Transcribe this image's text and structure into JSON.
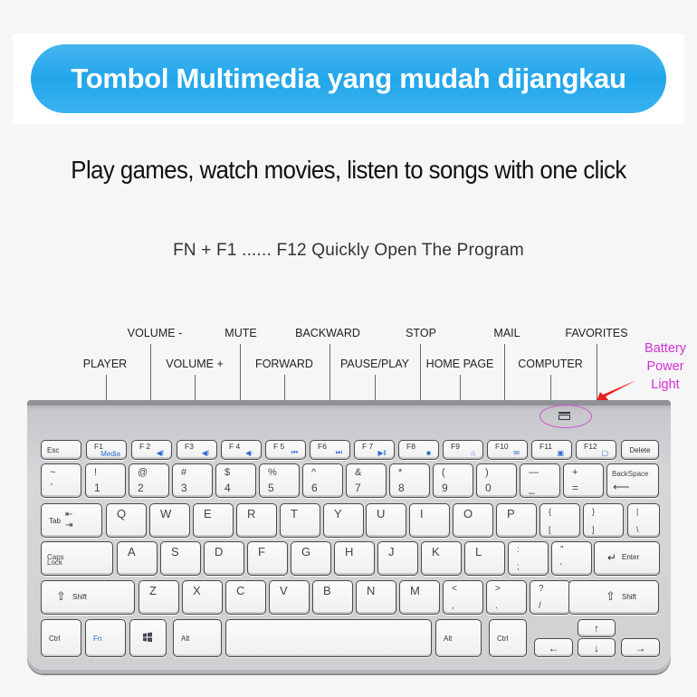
{
  "banner": {
    "title": "Tombol Multimedia yang mudah dijangkau",
    "color": "#22a6ec"
  },
  "subtitle": "Play games, watch movies, listen to songs with one click",
  "caption": "FN + F1 ...... F12 Quickly Open The Program",
  "function_labels": [
    {
      "key": "F1",
      "label": "PLAYER",
      "row": "lower"
    },
    {
      "key": "F2",
      "label": "VOLUME -",
      "row": "upper"
    },
    {
      "key": "F3",
      "label": "VOLUME +",
      "row": "lower"
    },
    {
      "key": "F4",
      "label": "MUTE",
      "row": "upper"
    },
    {
      "key": "F5",
      "label": "FORWARD",
      "row": "lower"
    },
    {
      "key": "F6",
      "label": "BACKWARD",
      "row": "upper"
    },
    {
      "key": "F7",
      "label": "PAUSE/PLAY",
      "row": "lower"
    },
    {
      "key": "F8",
      "label": "STOP",
      "row": "upper"
    },
    {
      "key": "F9",
      "label": "HOME PAGE",
      "row": "lower"
    },
    {
      "key": "F10",
      "label": "MAIL",
      "row": "upper"
    },
    {
      "key": "F11",
      "label": "COMPUTER",
      "row": "lower"
    },
    {
      "key": "F12",
      "label": "FAVORITES",
      "row": "upper"
    }
  ],
  "battery": {
    "label_lines": [
      "Battery",
      "Power",
      "Light"
    ],
    "color": "#d231d6",
    "icon": "battery-icon"
  },
  "keyboard": {
    "fn_row": [
      {
        "name": "Esc"
      },
      {
        "name": "F1",
        "sub": "Media"
      },
      {
        "name": "F 2",
        "icon": "◀ǀ"
      },
      {
        "name": "F3",
        "icon": "◀ǀ"
      },
      {
        "name": "F 4",
        "icon": "◀·"
      },
      {
        "name": "F 5",
        "icon": "⏮"
      },
      {
        "name": "F6",
        "icon": "⏭"
      },
      {
        "name": "F 7",
        "icon": "▶ǁ"
      },
      {
        "name": "F8",
        "icon": "■"
      },
      {
        "name": "F9",
        "icon": "⌂"
      },
      {
        "name": "F10",
        "icon": "✉"
      },
      {
        "name": "F11",
        "icon": "▣"
      },
      {
        "name": "F12",
        "icon": "▢"
      },
      {
        "name": "Delete"
      }
    ],
    "number_row": [
      {
        "top": "~",
        "bottom": "`"
      },
      {
        "top": "!",
        "bottom": "1"
      },
      {
        "top": "@",
        "bottom": "2"
      },
      {
        "top": "#",
        "bottom": "3"
      },
      {
        "top": "$",
        "bottom": "4"
      },
      {
        "top": "%",
        "bottom": "5"
      },
      {
        "top": "^",
        "bottom": "6"
      },
      {
        "top": "&",
        "bottom": "7"
      },
      {
        "top": "*",
        "bottom": "8"
      },
      {
        "top": "(",
        "bottom": "9"
      },
      {
        "top": ")",
        "bottom": "0"
      },
      {
        "top": "—",
        "bottom": "_"
      },
      {
        "top": "+",
        "bottom": "="
      },
      {
        "top": "BackSpace",
        "bottom": "⟵"
      }
    ],
    "qwerty_row": [
      "Tab",
      "Q",
      "W",
      "E",
      "R",
      "T",
      "Y",
      "U",
      "I",
      "O",
      "P",
      "{ [",
      "} ]",
      "| \\"
    ],
    "home_row": [
      "Caps Lock",
      "A",
      "S",
      "D",
      "F",
      "G",
      "H",
      "J",
      "K",
      "L",
      ": ;",
      "\" '",
      "Enter"
    ],
    "shift_row": [
      "Shift",
      "Z",
      "X",
      "C",
      "V",
      "B",
      "N",
      "M",
      "< ,",
      "> .",
      "? /",
      "Shift"
    ],
    "bottom_row": [
      "Ctrl",
      "Fn",
      "Win",
      "Alt",
      "",
      "Alt",
      "Ctrl"
    ],
    "arrows": {
      "up": "↑",
      "down": "↓",
      "left": "←",
      "right": "→"
    },
    "labels": {
      "tab": "Tab",
      "caps1": "Caps",
      "caps2": "Lock",
      "enter": "Enter",
      "shift": "Shift",
      "ctrl": "Ctrl",
      "fn": "Fn",
      "alt": "Alt"
    }
  }
}
